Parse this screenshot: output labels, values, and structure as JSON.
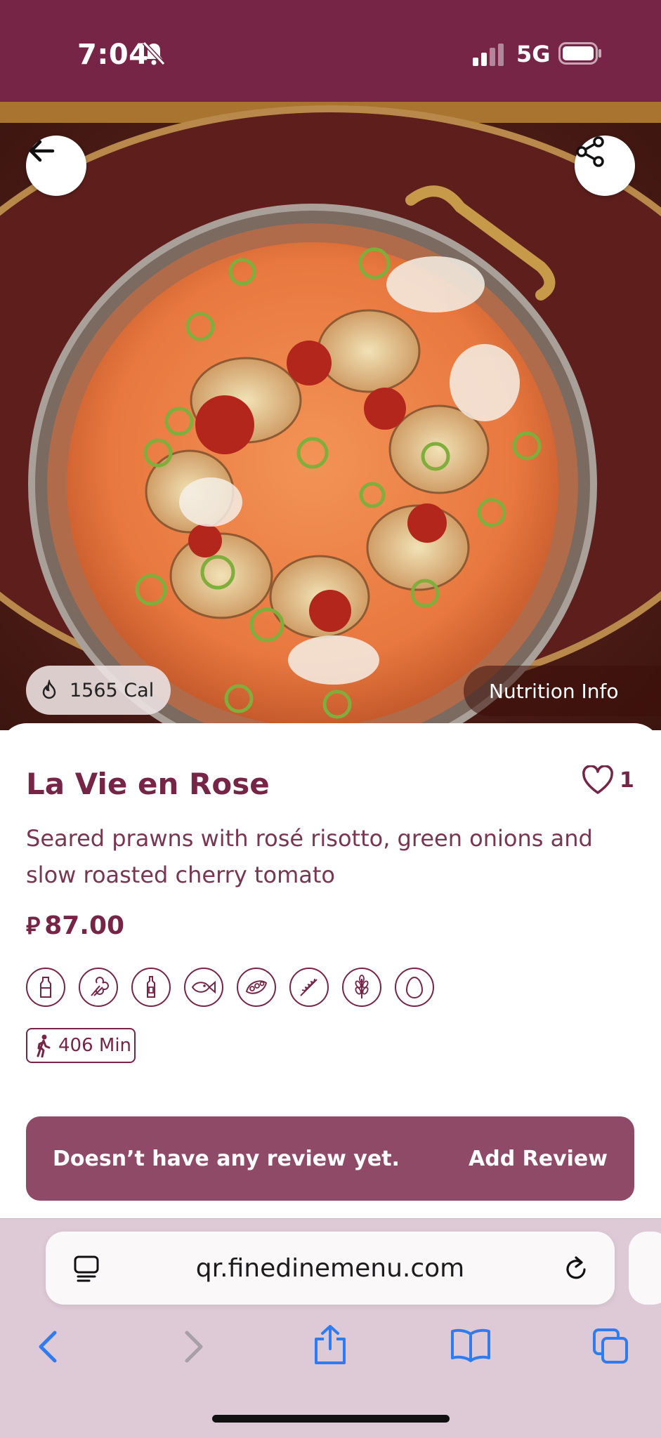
{
  "status_bar": {
    "time": "7:04",
    "network": "5G"
  },
  "hero": {
    "calories": "1565 Cal",
    "nutrition_label": "Nutrition Info"
  },
  "dish": {
    "name": "La Vie en Rose",
    "likes": "1",
    "description": "Seared prawns with rosé risotto, green onions and slow roasted cherry tomato",
    "currency_symbol": "⃁",
    "price": "87.00",
    "allergen_icons": [
      "milk-bottle-icon",
      "celery-icon",
      "sauce-bottle-icon",
      "fish-icon",
      "soy-bean-icon",
      "wheat-icon",
      "gluten-grain-icon",
      "egg-icon"
    ],
    "walk_time": "406 Min"
  },
  "review": {
    "message": "Doesn’t have any review yet.",
    "action": "Add Review"
  },
  "browser": {
    "url": "qr.finedinemenu.com"
  },
  "colors": {
    "brand": "#762547",
    "review_bar": "#8f4a67",
    "browser_bg": "#ddcad6"
  }
}
